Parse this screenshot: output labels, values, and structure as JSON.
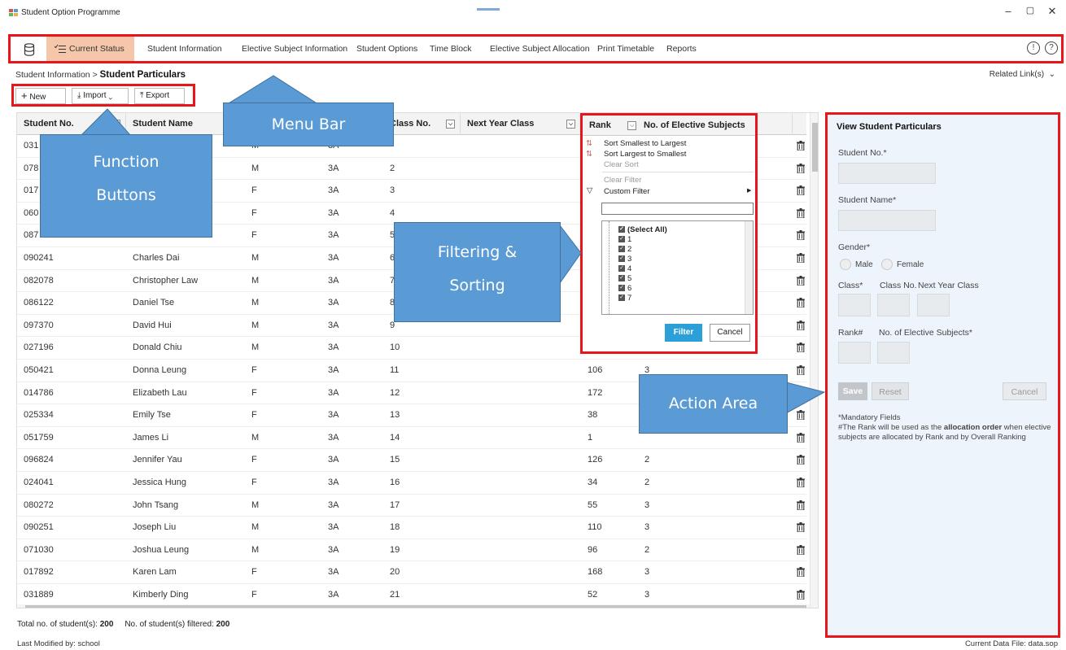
{
  "window": {
    "title": "Student Option Programme",
    "controls": [
      "–",
      "▢",
      "✕"
    ]
  },
  "menu": {
    "items": [
      {
        "label": "Current Status",
        "active": true
      },
      {
        "label": "Student Information"
      },
      {
        "label": "Elective Subject Information"
      },
      {
        "label": "Student Options"
      },
      {
        "label": "Time Block"
      },
      {
        "label": "Elective Subject Allocation"
      },
      {
        "label": "Print Timetable"
      },
      {
        "label": "Reports"
      }
    ],
    "right_icons": [
      "info-icon",
      "help-icon"
    ]
  },
  "breadcrumb": {
    "parent": "Student Information",
    "separator": ">",
    "current": "Student Particulars"
  },
  "related_links": "Related Link(s)",
  "function_buttons": [
    {
      "label": "New",
      "icon": "plus-icon"
    },
    {
      "label": "Import",
      "icon": "download-icon"
    },
    {
      "label": "Export",
      "icon": "upload-icon"
    }
  ],
  "grid": {
    "columns": [
      "Student No.",
      "Student Name",
      "",
      "",
      "Class No.",
      "Next Year Class",
      "Rank",
      "No. of Elective Subjects"
    ],
    "rows": [
      {
        "no": "031",
        "name": "",
        "gender": "M",
        "cls": "3A",
        "cno": "",
        "rank": "",
        "elec": ""
      },
      {
        "no": "078",
        "name": "",
        "gender": "M",
        "cls": "3A",
        "cno": "2",
        "rank": "",
        "elec": ""
      },
      {
        "no": "017",
        "name": "",
        "gender": "F",
        "cls": "3A",
        "cno": "3",
        "rank": "",
        "elec": ""
      },
      {
        "no": "060",
        "name": "",
        "gender": "F",
        "cls": "3A",
        "cno": "4",
        "rank": "",
        "elec": ""
      },
      {
        "no": "087",
        "name": "",
        "gender": "F",
        "cls": "3A",
        "cno": "5",
        "rank": "",
        "elec": ""
      },
      {
        "no": "090241",
        "name": "Charles Dai",
        "gender": "M",
        "cls": "3A",
        "cno": "6",
        "rank": "",
        "elec": ""
      },
      {
        "no": "082078",
        "name": "Christopher Law",
        "gender": "M",
        "cls": "3A",
        "cno": "7",
        "rank": "",
        "elec": ""
      },
      {
        "no": "086122",
        "name": "Daniel Tse",
        "gender": "M",
        "cls": "3A",
        "cno": "8",
        "rank": "",
        "elec": ""
      },
      {
        "no": "097370",
        "name": "David Hui",
        "gender": "M",
        "cls": "3A",
        "cno": "9",
        "rank": "",
        "elec": ""
      },
      {
        "no": "027196",
        "name": "Donald Chiu",
        "gender": "M",
        "cls": "3A",
        "cno": "10",
        "rank": "",
        "elec": ""
      },
      {
        "no": "050421",
        "name": "Donna Leung",
        "gender": "F",
        "cls": "3A",
        "cno": "11",
        "rank": "106",
        "elec": "3"
      },
      {
        "no": "014786",
        "name": "Elizabeth Lau",
        "gender": "F",
        "cls": "3A",
        "cno": "12",
        "rank": "172",
        "elec": ""
      },
      {
        "no": "025334",
        "name": "Emily Tse",
        "gender": "F",
        "cls": "3A",
        "cno": "13",
        "rank": "38",
        "elec": ""
      },
      {
        "no": "051759",
        "name": "James Li",
        "gender": "M",
        "cls": "3A",
        "cno": "14",
        "rank": "1",
        "elec": ""
      },
      {
        "no": "096824",
        "name": "Jennifer Yau",
        "gender": "F",
        "cls": "3A",
        "cno": "15",
        "rank": "126",
        "elec": "2"
      },
      {
        "no": "024041",
        "name": "Jessica Hung",
        "gender": "F",
        "cls": "3A",
        "cno": "16",
        "rank": "34",
        "elec": "2"
      },
      {
        "no": "080272",
        "name": "John Tsang",
        "gender": "M",
        "cls": "3A",
        "cno": "17",
        "rank": "55",
        "elec": "3"
      },
      {
        "no": "090251",
        "name": "Joseph Liu",
        "gender": "M",
        "cls": "3A",
        "cno": "18",
        "rank": "110",
        "elec": "3"
      },
      {
        "no": "071030",
        "name": "Joshua Leung",
        "gender": "M",
        "cls": "3A",
        "cno": "19",
        "rank": "96",
        "elec": "2"
      },
      {
        "no": "017892",
        "name": "Karen Lam",
        "gender": "F",
        "cls": "3A",
        "cno": "20",
        "rank": "168",
        "elec": "3"
      },
      {
        "no": "031889",
        "name": "Kimberly Ding",
        "gender": "F",
        "cls": "3A",
        "cno": "21",
        "rank": "52",
        "elec": "3"
      }
    ]
  },
  "filter_popup": {
    "sort_asc": "Sort Smallest to Largest",
    "sort_desc": "Sort Largest to Smallest",
    "clear_sort": "Clear Sort",
    "clear_filter": "Clear Filter",
    "custom_filter": "Custom Filter",
    "list": [
      "(Select All)",
      "1",
      "2",
      "3",
      "4",
      "5",
      "6",
      "7"
    ],
    "filter_btn": "Filter",
    "cancel_btn": "Cancel"
  },
  "panel": {
    "title": "View Student Particulars",
    "student_no": "Student No.*",
    "student_name": "Student Name*",
    "gender": "Gender*",
    "male": "Male",
    "female": "Female",
    "class": "Class*",
    "class_no": "Class No.",
    "next_year_class": "Next Year Class",
    "rank": "Rank#",
    "no_elective": "No. of Elective Subjects*",
    "save": "Save",
    "reset": "Reset",
    "cancel": "Cancel",
    "note1": "*Mandatory Fields",
    "note2_pre": "#The Rank will be used as the ",
    "note2_bold": "allocation order",
    "note2_post": " when elective subjects are allocated by Rank and by Overall Ranking"
  },
  "callouts": {
    "menu_bar": "Menu Bar",
    "function_line1": "Function",
    "function_line2": "Buttons",
    "filter_line1": "Filtering &",
    "filter_line2": "Sorting",
    "action_area": "Action Area"
  },
  "footer": {
    "total_label": "Total no. of student(s):",
    "total_value": "200",
    "filtered_label": "No. of student(s) filtered:",
    "filtered_value": "200",
    "modified": "Last Modified by: school",
    "data_file": "Current Data File: data.sop"
  },
  "colors": {
    "highlight": "#e8151b",
    "callout": "#5b9bd5",
    "active_menu": "#f5c6aa",
    "filter_button": "#2a9fd8"
  }
}
